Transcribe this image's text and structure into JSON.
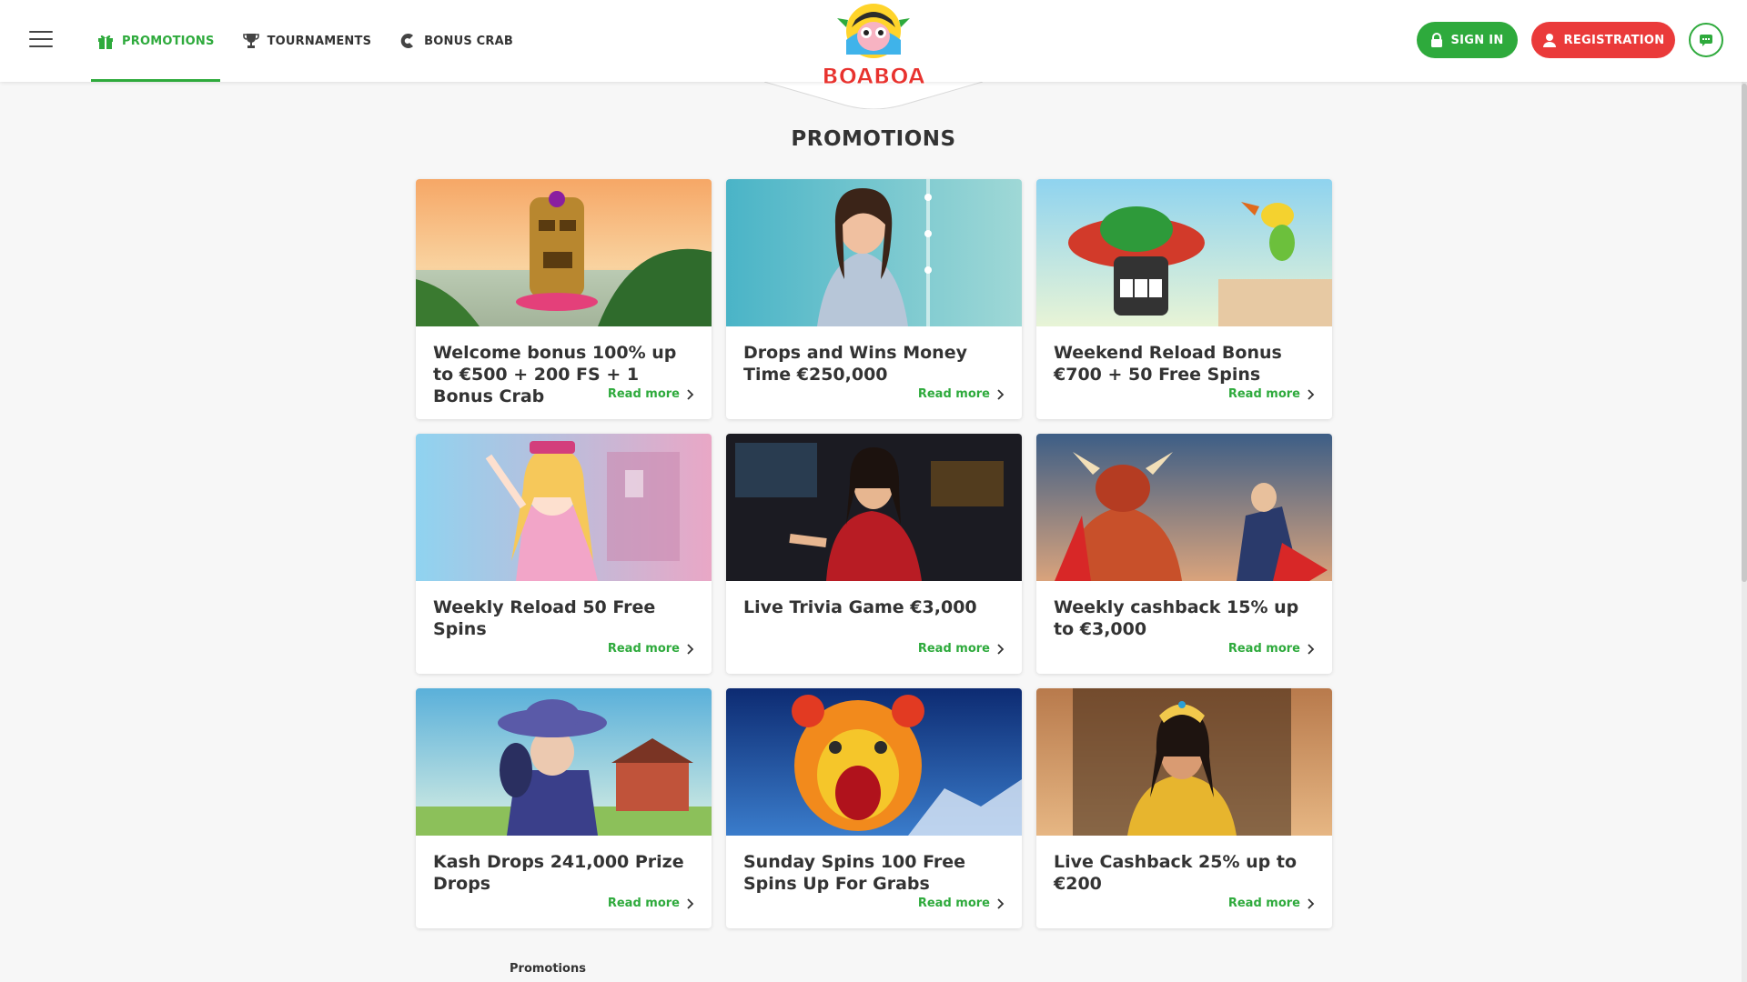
{
  "header": {
    "nav": [
      {
        "label": "PROMOTIONS",
        "icon": "gift-icon",
        "active": true
      },
      {
        "label": "TOURNAMENTS",
        "icon": "trophy-icon",
        "active": false
      },
      {
        "label": "BONUS CRAB",
        "icon": "crab-claw-icon",
        "active": false
      }
    ],
    "logo_text": "BOABOA",
    "sign_in_label": "SIGN IN",
    "registration_label": "REGISTRATION",
    "colors": {
      "accent": "#2eaa3c",
      "registration": "#ea3a3a"
    }
  },
  "main": {
    "title": "PROMOTIONS",
    "cards": [
      {
        "title": "Welcome bonus 100% up to €500 + 200 FS + 1 Bonus Crab",
        "more": "Read more"
      },
      {
        "title": "Drops and Wins Money Time €250,000",
        "more": "Read more"
      },
      {
        "title": "Weekend Reload Bonus €700 + 50 Free Spins",
        "more": "Read more"
      },
      {
        "title": "Weekly Reload 50 Free Spins",
        "more": "Read more"
      },
      {
        "title": "Live Trivia Game €3,000",
        "more": "Read more"
      },
      {
        "title": "Weekly cashback 15% up to €3,000",
        "more": "Read more"
      },
      {
        "title": "Kash Drops 241,000 Prize Drops",
        "more": "Read more"
      },
      {
        "title": "Sunday Spins 100 Free Spins Up For Grabs",
        "more": "Read more"
      },
      {
        "title": "Live Cashback 25% up to €200",
        "more": "Read more"
      }
    ]
  },
  "footer": {
    "breadcrumb": "Promotions"
  }
}
